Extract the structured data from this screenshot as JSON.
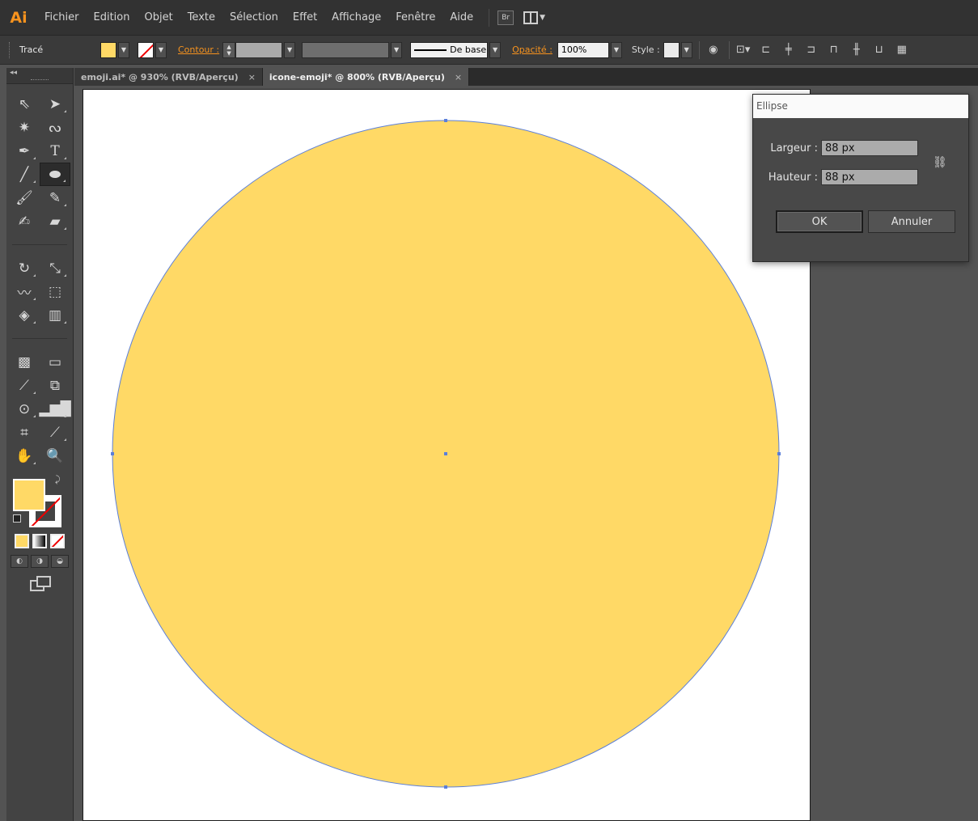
{
  "app": {
    "logo": "Ai"
  },
  "menu": [
    "Fichier",
    "Edition",
    "Objet",
    "Texte",
    "Sélection",
    "Effet",
    "Affichage",
    "Fenêtre",
    "Aide"
  ],
  "menu_extra": {
    "bridge": "Br"
  },
  "controlbar": {
    "selection_label": "Tracé",
    "stroke_label": "Contour :",
    "stroke_style": "De base",
    "opacity_label": "Opacité :",
    "opacity_value": "100%",
    "style_label": "Style :",
    "fill_color": "#ffd966"
  },
  "tools_header": {
    "collapse": "◂◂"
  },
  "tabs": [
    {
      "label": "emoji.ai* @ 930% (RVB/Aperçu)",
      "close": "×",
      "active": false
    },
    {
      "label": "icone-emoji* @ 800% (RVB/Aperçu)",
      "close": "×",
      "active": true
    }
  ],
  "canvas": {
    "ellipse_fill": "#ffd966",
    "selection_color": "#5b7fd9"
  },
  "dialog": {
    "title": "Ellipse",
    "width_label": "Largeur :",
    "width_value": "88 px",
    "height_label": "Hauteur :",
    "height_value": "88 px",
    "ok": "OK",
    "cancel": "Annuler"
  },
  "icons": {
    "tools": [
      "selection-tool",
      "direct-selection-tool",
      "magic-wand-tool",
      "lasso-tool",
      "pen-tool",
      "type-tool",
      "line-segment-tool",
      "ellipse-tool",
      "paintbrush-tool",
      "pencil-tool",
      "blob-brush-tool",
      "eraser-tool",
      "rotate-tool",
      "scale-tool",
      "warp-tool",
      "free-transform-tool",
      "shape-builder-tool",
      "perspective-grid-tool",
      "mesh-tool",
      "gradient-tool",
      "eyedropper-tool",
      "blend-tool",
      "symbol-sprayer-tool",
      "column-graph-tool",
      "artboard-tool",
      "slice-tool",
      "hand-tool",
      "zoom-tool"
    ]
  }
}
